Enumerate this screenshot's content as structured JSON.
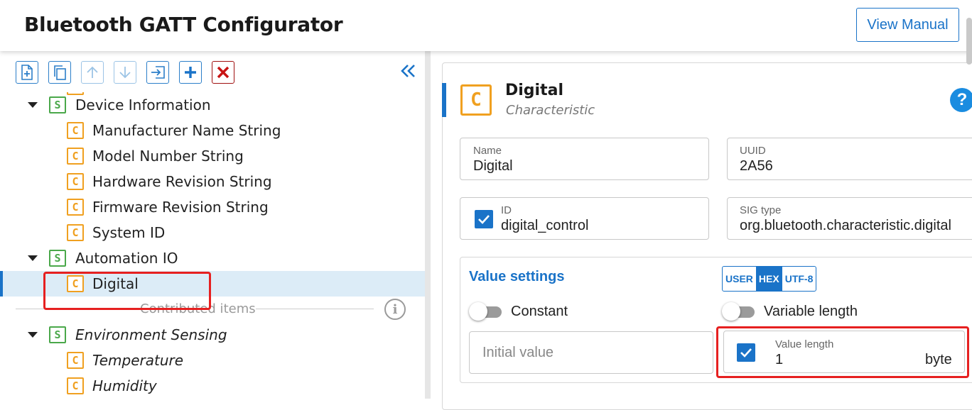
{
  "app": {
    "title": "Bluetooth GATT Configurator",
    "view_manual_label": "View Manual"
  },
  "toolbar": {
    "buttons": [
      {
        "name": "add-item-button",
        "icon": "file-plus-icon"
      },
      {
        "name": "duplicate-button",
        "icon": "copy-icon"
      },
      {
        "name": "move-up-button",
        "icon": "arrow-up-icon"
      },
      {
        "name": "move-down-button",
        "icon": "arrow-down-icon"
      },
      {
        "name": "import-button",
        "icon": "import-icon"
      },
      {
        "name": "add-button",
        "icon": "plus-icon"
      },
      {
        "name": "delete-button",
        "icon": "x-icon"
      }
    ],
    "collapse_icon": "double-chevron-left-icon"
  },
  "tree": {
    "device_information": {
      "badge": "S",
      "label": "Device Information",
      "children": [
        {
          "badge": "C",
          "label": "Manufacturer Name String"
        },
        {
          "badge": "C",
          "label": "Model Number String"
        },
        {
          "badge": "C",
          "label": "Hardware Revision String"
        },
        {
          "badge": "C",
          "label": "Firmware Revision String"
        },
        {
          "badge": "C",
          "label": "System ID"
        }
      ]
    },
    "automation_io": {
      "badge": "S",
      "label": "Automation IO",
      "children": [
        {
          "badge": "C",
          "label": "Digital",
          "selected": true
        }
      ]
    },
    "contributed_label": "Contributed items",
    "info_icon": "i",
    "environment_sensing": {
      "badge": "S",
      "label": "Environment Sensing",
      "children": [
        {
          "badge": "C",
          "label": "Temperature"
        },
        {
          "badge": "C",
          "label": "Humidity"
        }
      ]
    }
  },
  "detail": {
    "badge": "C",
    "name": "Digital",
    "type": "Characteristic",
    "help_label": "?",
    "fields": {
      "name_label": "Name",
      "name_value": "Digital",
      "uuid_label": "UUID",
      "uuid_value": "2A56",
      "id_label": "ID",
      "id_value": "digital_control",
      "id_checked": true,
      "sig_label": "SIG type",
      "sig_value": "org.bluetooth.characteristic.digital"
    },
    "value_settings": {
      "title": "Value settings",
      "encodings": [
        "USER",
        "HEX",
        "UTF-8"
      ],
      "active_encoding": "HEX",
      "constant_label": "Constant",
      "constant_on": false,
      "variable_length_label": "Variable length",
      "variable_length_on": false,
      "initial_value_placeholder": "Initial value",
      "value_length_label": "Value length",
      "value_length_value": "1",
      "value_length_unit": "byte",
      "value_length_checked": true
    }
  },
  "colors": {
    "accent": "#1a73c8",
    "service_badge": "#4aa84a",
    "characteristic_badge": "#f0a020",
    "highlight_red": "#e62020",
    "delete_red": "#c81414"
  }
}
